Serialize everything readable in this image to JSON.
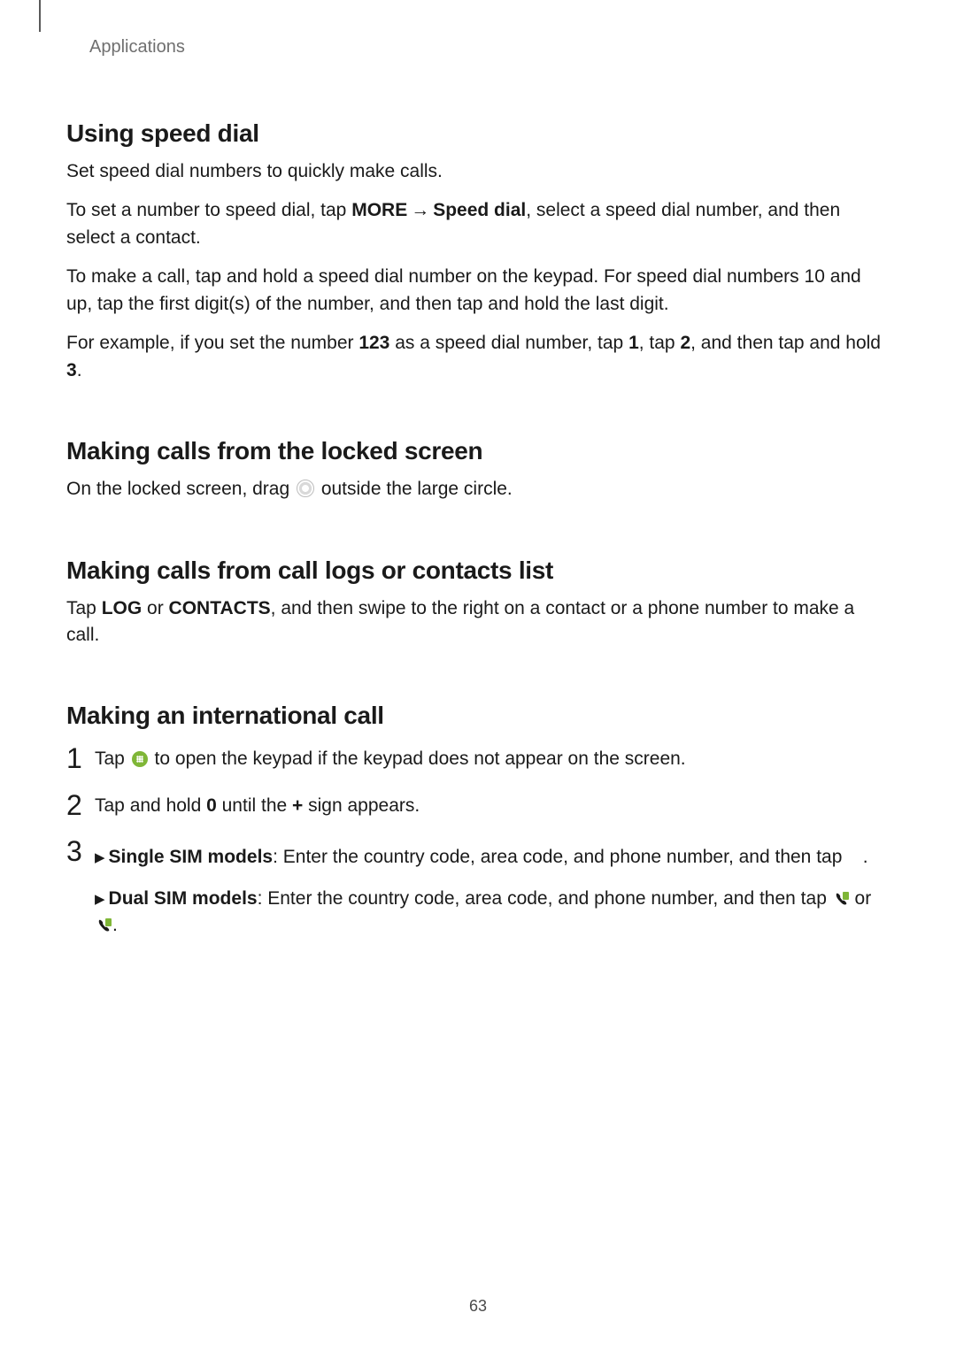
{
  "breadcrumb": "Applications",
  "page_number": "63",
  "sections": {
    "speed_dial": {
      "title": "Using speed dial",
      "p1": "Set speed dial numbers to quickly make calls.",
      "p2a": "To set a number to speed dial, tap ",
      "p2_more": "MORE",
      "p2_arrow": " → ",
      "p2_speed": "Speed dial",
      "p2b": ", select a speed dial number, and then select a contact.",
      "p3": "To make a call, tap and hold a speed dial number on the keypad. For speed dial numbers 10 and up, tap the first digit(s) of the number, and then tap and hold the last digit.",
      "p4a": "For example, if you set the number ",
      "p4_123": "123",
      "p4b": " as a speed dial number, tap ",
      "p4_1": "1",
      "p4c": ", tap ",
      "p4_2": "2",
      "p4d": ", and then tap and hold ",
      "p4_3": "3",
      "p4e": "."
    },
    "locked": {
      "title": "Making calls from the locked screen",
      "p1a": "On the locked screen, drag ",
      "p1b": " outside the large circle."
    },
    "logs": {
      "title": "Making calls from call logs or contacts list",
      "p1a": "Tap ",
      "p1_log": "LOG",
      "p1b": " or ",
      "p1_contacts": "CONTACTS",
      "p1c": ", and then swipe to the right on a contact or a phone number to make a call."
    },
    "intl": {
      "title": "Making an international call",
      "steps": {
        "s1a": "Tap ",
        "s1b": " to open the keypad if the keypad does not appear on the screen.",
        "s2a": "Tap and hold ",
        "s2_0": "0",
        "s2b": " until the ",
        "s2_plus": "+",
        "s2c": " sign appears.",
        "s3_single_label": "Single SIM models",
        "s3_single_text": ": Enter the country code, area code, and phone number, and then tap ",
        "s3_single_end": ".",
        "s3_dual_label": "Dual SIM models",
        "s3_dual_text": ": Enter the country code, area code, and phone number, and then tap ",
        "s3_or": " or ",
        "s3_dual_end": "."
      }
    }
  }
}
